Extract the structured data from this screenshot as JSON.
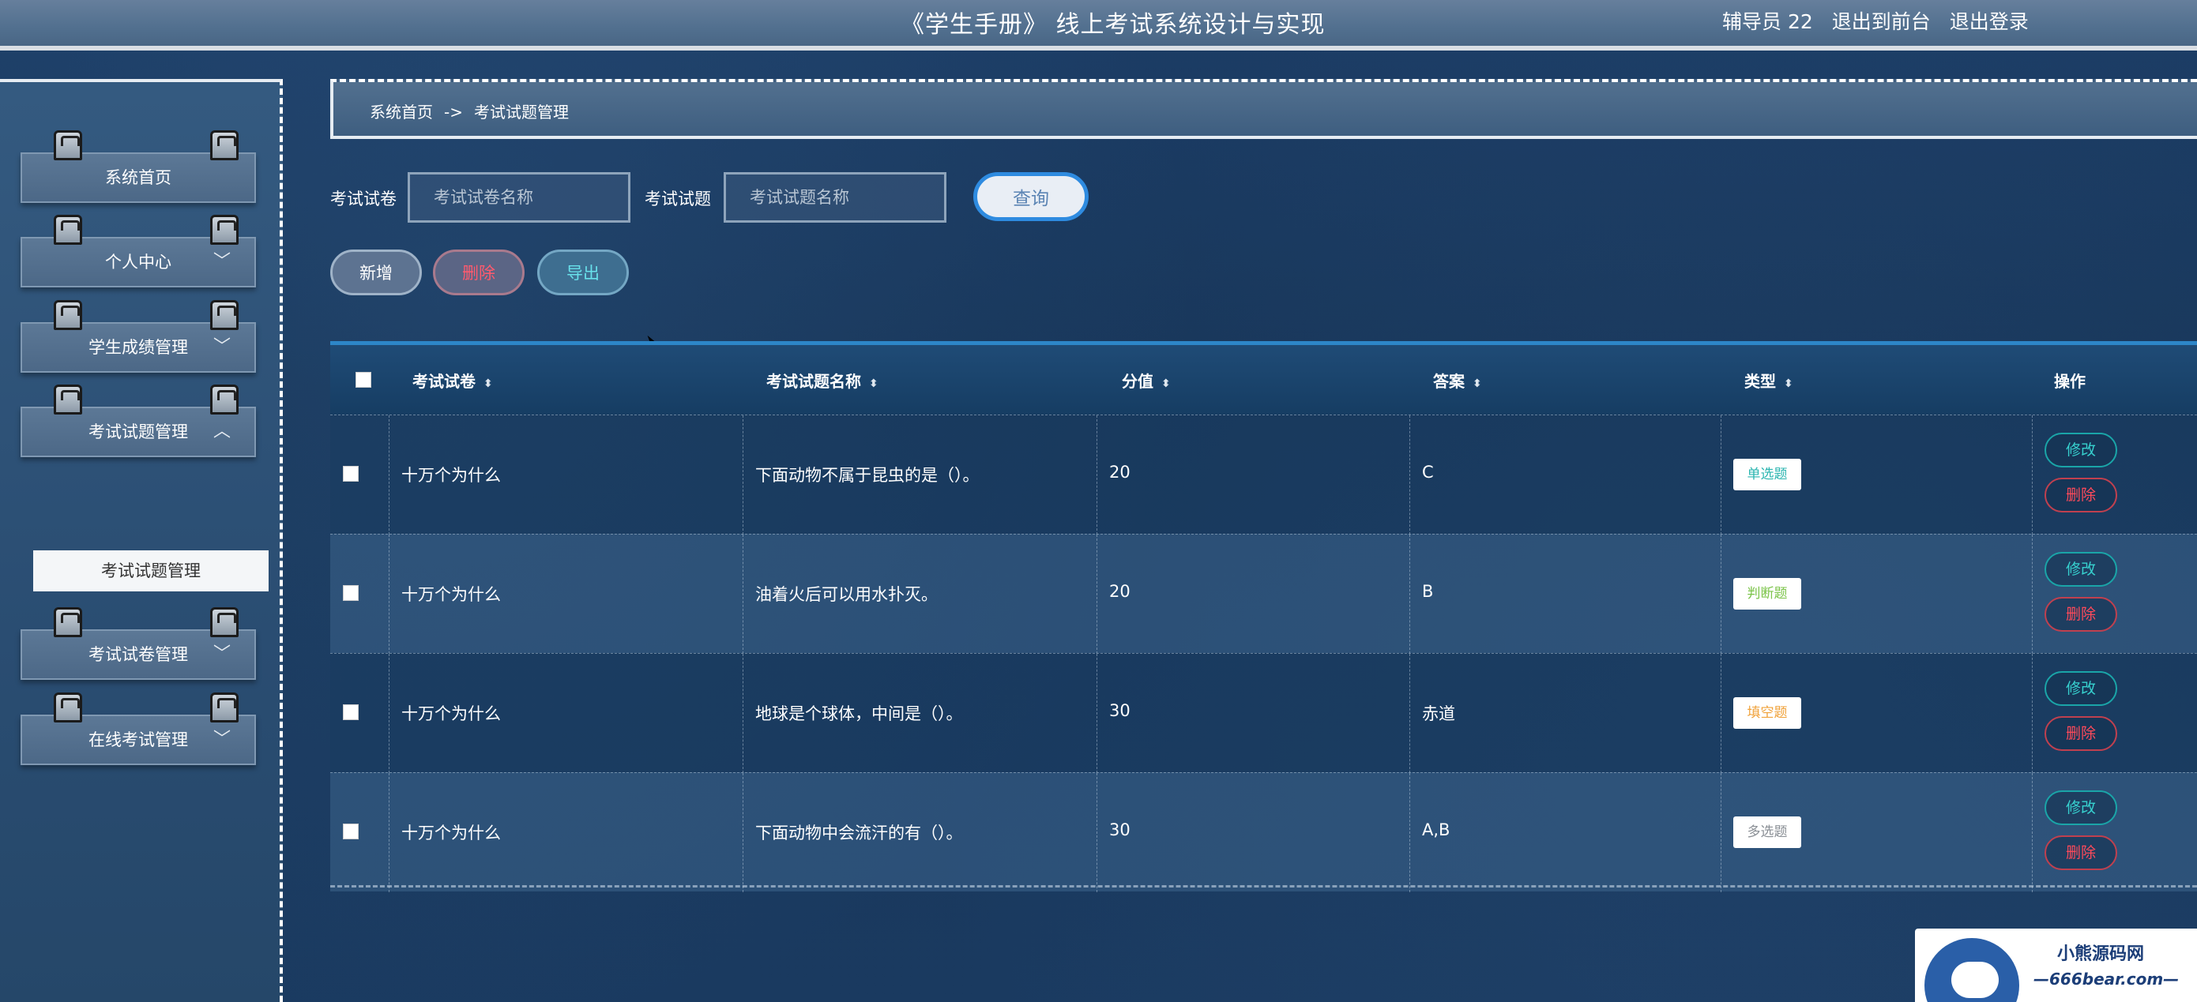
{
  "header": {
    "title": "《学生手册》 线上考试系统设计与实现",
    "user": "辅导员 22",
    "front_link": "退出到前台",
    "logout_link": "退出登录"
  },
  "sidebar": {
    "items": [
      {
        "label": "系统首页",
        "chevron": ""
      },
      {
        "label": "个人中心",
        "chevron": "﹀"
      },
      {
        "label": "学生成绩管理",
        "chevron": "﹀"
      },
      {
        "label": "考试试题管理",
        "chevron": "︿"
      },
      {
        "label": "考试试卷管理",
        "chevron": "﹀"
      },
      {
        "label": "在线考试管理",
        "chevron": "﹀"
      }
    ],
    "submenu_active": "考试试题管理"
  },
  "breadcrumb": {
    "home": "系统首页",
    "sep": "->",
    "current": "考试试题管理"
  },
  "search": {
    "paper_label": "考试试卷",
    "paper_placeholder": "考试试卷名称",
    "question_label": "考试试题",
    "question_placeholder": "考试试题名称",
    "query_button": "查询"
  },
  "actions": {
    "add": "新增",
    "delete": "删除",
    "export": "导出"
  },
  "table": {
    "columns": [
      "考试试卷",
      "考试试题名称",
      "分值",
      "答案",
      "类型",
      "操作"
    ],
    "rows": [
      {
        "paper": "十万个为什么",
        "question": "下面动物不属于昆虫的是（）。",
        "score": "20",
        "answer": "C",
        "type": "单选题",
        "type_color": "#2bb5b0"
      },
      {
        "paper": "十万个为什么",
        "question": "油着火后可以用水扑灭。",
        "score": "20",
        "answer": "B",
        "type": "判断题",
        "type_color": "#7cc44a"
      },
      {
        "paper": "十万个为什么",
        "question": "地球是个球体，中间是（）。",
        "score": "30",
        "answer": "赤道",
        "type": "填空题",
        "type_color": "#f0a23a"
      },
      {
        "paper": "十万个为什么",
        "question": "下面动物中会流汗的有（）。",
        "score": "30",
        "answer": "A,B",
        "type": "多选题",
        "type_color": "#8a8f95"
      }
    ],
    "edit_label": "修改",
    "delete_label": "删除"
  },
  "watermark": {
    "name": "小熊源码网",
    "site": "—666bear.com—"
  }
}
